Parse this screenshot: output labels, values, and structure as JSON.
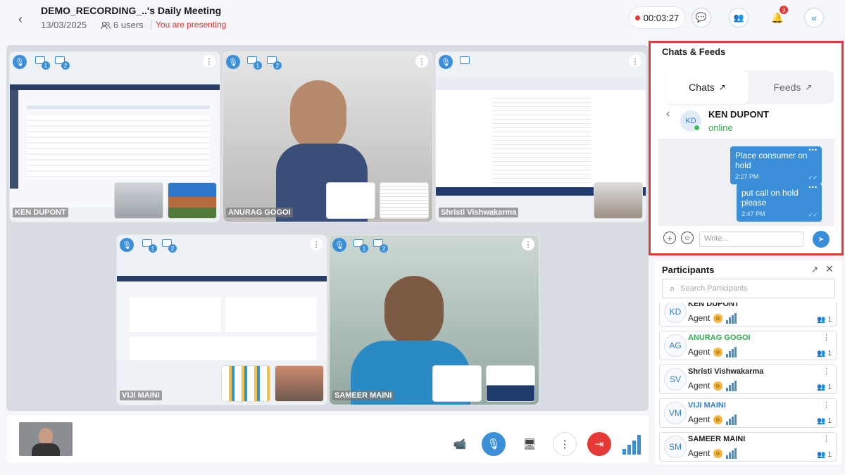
{
  "header": {
    "title": "DEMO_RECORDING_..'s Daily Meeting",
    "date": "13/03/2025",
    "users": "6 users",
    "presenting": "You are presenting",
    "timer": "00:03:27",
    "notif_count": "3"
  },
  "tiles": [
    {
      "name": "KEN DUPONT",
      "screen1": "1",
      "screen2": "2"
    },
    {
      "name": "ANURAG GOGOI",
      "screen1": "1",
      "screen2": "2"
    },
    {
      "name": "Shristi Vishwakarma"
    },
    {
      "name": "VIJI MAINI",
      "screen1": "1",
      "screen2": "2"
    },
    {
      "name": "SAMEER MAINI",
      "screen1": "1",
      "screen2": "2"
    }
  ],
  "chat": {
    "title": "Chats & Feeds",
    "tab_chats": "Chats",
    "tab_feeds": "Feeds",
    "contact_initials": "KD",
    "contact_name": "KEN DUPONT",
    "contact_status": "online",
    "messages": [
      {
        "text": "Place consumer on hold",
        "time": "2:27 PM"
      },
      {
        "text": "put call on hold please",
        "time": "2:47 PM"
      }
    ],
    "input_placeholder": "Write..."
  },
  "participants": {
    "title": "Participants",
    "search_placeholder": "Search Participants",
    "list": [
      {
        "initials": "KD",
        "name": "KEN DUPONT",
        "role": "Agent",
        "count": "1",
        "color": "#1a1a1a"
      },
      {
        "initials": "AG",
        "name": "ANURAG GOGOI",
        "role": "Agent",
        "count": "1",
        "color": "#2fae51"
      },
      {
        "initials": "SV",
        "name": "Shristi Vishwakarma",
        "role": "Agent",
        "count": "1",
        "color": "#1a1a1a"
      },
      {
        "initials": "VM",
        "name": "VIJI MAINI",
        "role": "Agent",
        "count": "1",
        "color": "#2f80d0"
      },
      {
        "initials": "SM",
        "name": "SAMEER MAINI",
        "role": "Agent",
        "count": "1",
        "color": "#1a1a1a"
      }
    ]
  },
  "colors": {
    "accent": "#3b8fd9",
    "danger": "#e53935",
    "online": "#2fae51"
  }
}
